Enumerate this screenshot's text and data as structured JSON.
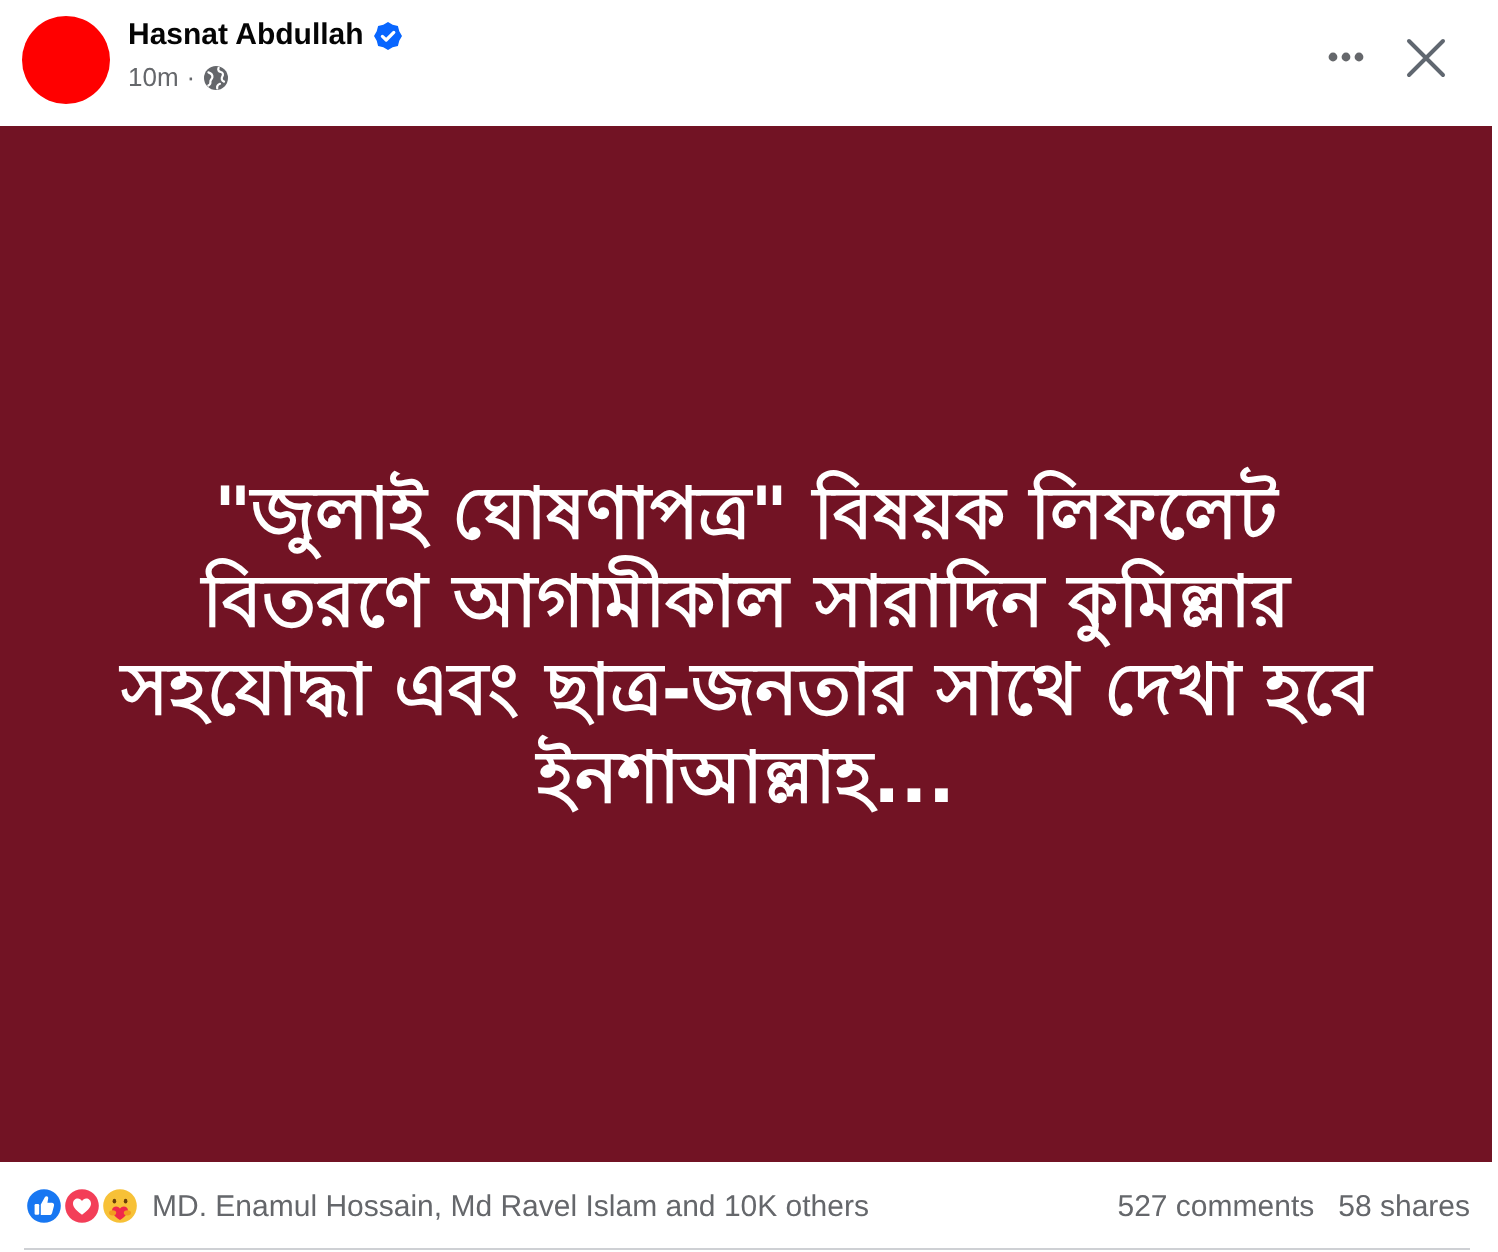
{
  "post": {
    "author": {
      "name": "Hasnat Abdullah",
      "verified": true
    },
    "time": "10m",
    "separator": "·",
    "text": "\"জুলাই ঘোষণাপত্র\" বিষয়ক লিফলেট বিতরণে আগামীকাল সারাদিন কুমিল্লার সহযোদ্ধা এবং ছাত্র-জনতার সাথে দেখা হবে ইনশাআল্লাহ...",
    "reactions": {
      "types": [
        {
          "kind": "like"
        },
        {
          "kind": "love"
        },
        {
          "kind": "care"
        }
      ],
      "summary": "MD. Enamul Hossain, Md Ravel Islam and 10K others"
    },
    "comments": "527 comments",
    "shares": "58 shares"
  }
}
